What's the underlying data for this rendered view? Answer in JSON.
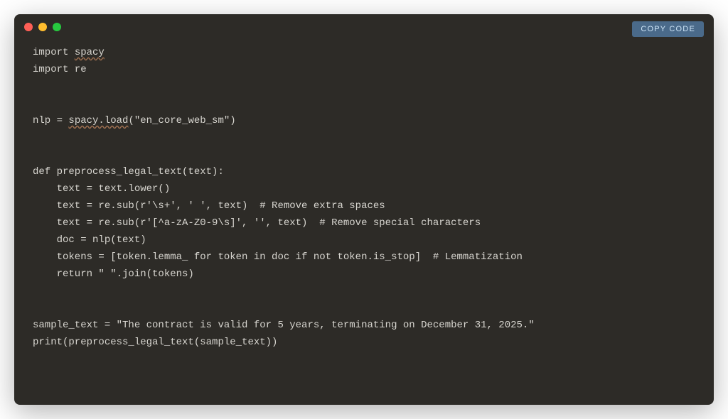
{
  "copy_button_label": "COPY CODE",
  "code": {
    "line1_a": "import ",
    "line1_b": "spacy",
    "line2": "import re",
    "blank": "",
    "line3_a": "nlp = ",
    "line3_b": "spacy.load",
    "line3_c": "(\"en_core_web_sm\")",
    "line4": "def preprocess_legal_text(text):",
    "line5": "    text = text.lower()",
    "line6": "    text = re.sub(r'\\s+', ' ', text)  # Remove extra spaces",
    "line7": "    text = re.sub(r'[^a-zA-Z0-9\\s]', '', text)  # Remove special characters",
    "line8": "    doc = nlp(text)",
    "line9": "    tokens = [token.lemma_ for token in doc if not token.is_stop]  # Lemmatization",
    "line10": "    return \" \".join(tokens)",
    "line11": "sample_text = \"The contract is valid for 5 years, terminating on December 31, 2025.\"",
    "line12": "print(preprocess_legal_text(sample_text))"
  }
}
